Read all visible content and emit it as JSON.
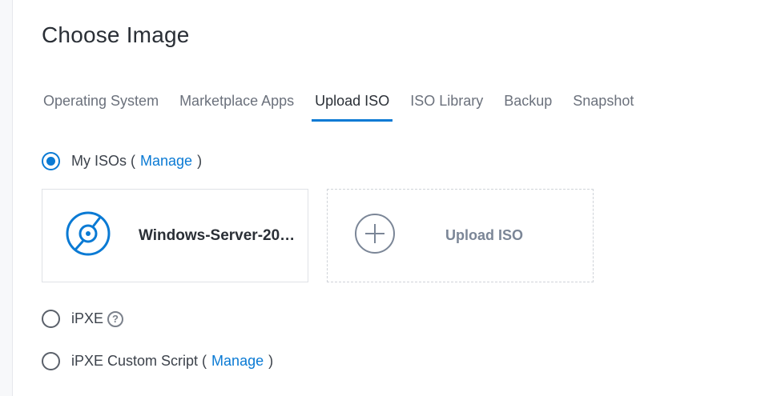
{
  "page": {
    "title": "Choose Image"
  },
  "tabs": [
    {
      "label": "Operating System",
      "active": false
    },
    {
      "label": "Marketplace Apps",
      "active": false
    },
    {
      "label": "Upload ISO",
      "active": true
    },
    {
      "label": "ISO Library",
      "active": false
    },
    {
      "label": "Backup",
      "active": false
    },
    {
      "label": "Snapshot",
      "active": false
    }
  ],
  "options": {
    "my_isos": {
      "label": "My ISOs",
      "open": "(",
      "manage": "Manage",
      "close": ")",
      "selected": true
    },
    "ipxe": {
      "label": "iPXE",
      "help_glyph": "?",
      "selected": false
    },
    "ipxe_custom": {
      "label": "iPXE Custom Script",
      "open": "(",
      "manage": "Manage",
      "close": ")",
      "selected": false
    }
  },
  "iso_cards": {
    "existing": {
      "name": "Windows-Server-20…",
      "icon": "disc-icon"
    },
    "upload": {
      "label": "Upload ISO",
      "icon": "plus-circle-icon"
    }
  },
  "colors": {
    "accent": "#0a7ad4",
    "muted": "#7b8697"
  }
}
